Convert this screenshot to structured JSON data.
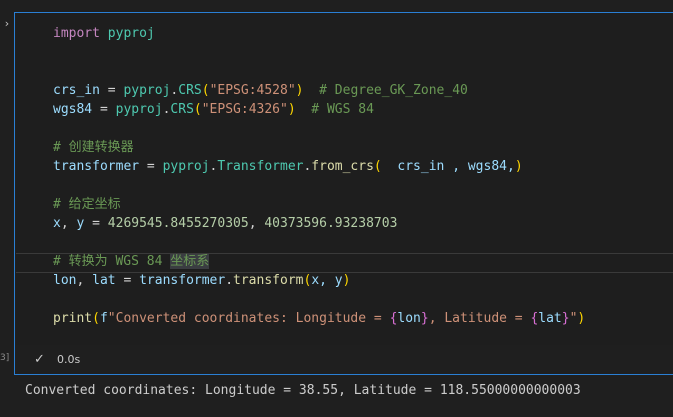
{
  "cell": {
    "execution_count": "3]",
    "lines": [
      {
        "kw": "import",
        "mod": "pyproj"
      },
      {
        "var1": "crs_in",
        "eq": " = ",
        "mod": "pyproj",
        "dot": ".",
        "fn": "CRS",
        "open": "(",
        "str": "\"EPSG:4528\"",
        "close": ")",
        "comment": "  # Degree_GK_Zone_40"
      },
      {
        "var1": "wgs84",
        "eq": " = ",
        "mod": "pyproj",
        "dot": ".",
        "fn": "CRS",
        "open": "(",
        "str": "\"EPSG:4326\"",
        "close": ")",
        "comment": "  # WGS 84"
      },
      {
        "comment": "# 创建转换器"
      },
      {
        "var1": "transformer",
        "eq": " = ",
        "mod": "pyproj",
        "dot": ".",
        "cls": "Transformer",
        "dot2": ".",
        "fn": "from_crs",
        "open": "(",
        "args": "  crs_in , wgs84,",
        "close": ")"
      },
      {
        "comment": "# 给定坐标"
      },
      {
        "var1": "x",
        "comma": ", ",
        "var2": "y",
        "eq": " = ",
        "num1": "4269545.8455270305",
        "sep": ", ",
        "num2": "40373596.93238703"
      },
      {
        "comment_a": "# 转换为 WGS 84 ",
        "comment_b": "坐标系"
      },
      {
        "var1": "lon",
        "comma": ", ",
        "var2": "lat",
        "eq": " = ",
        "obj": "transformer",
        "dot": ".",
        "fn": "transform",
        "open": "(",
        "args": "x, y",
        "close": ")"
      },
      {
        "fn": "print",
        "open": "(",
        "fprefix": "f",
        "s1": "\"Converted coordinates: Longitude = ",
        "b1o": "{",
        "v1": "lon",
        "b1c": "}",
        "s2": ", Latitude = ",
        "b2o": "{",
        "v2": "lat",
        "b2c": "}",
        "s3": "\"",
        "close": ")"
      }
    ],
    "status": {
      "check_icon": "✓",
      "time": "0.0s"
    }
  },
  "output": "Converted coordinates: Longitude = 38.55, Latitude = 118.55000000000003"
}
